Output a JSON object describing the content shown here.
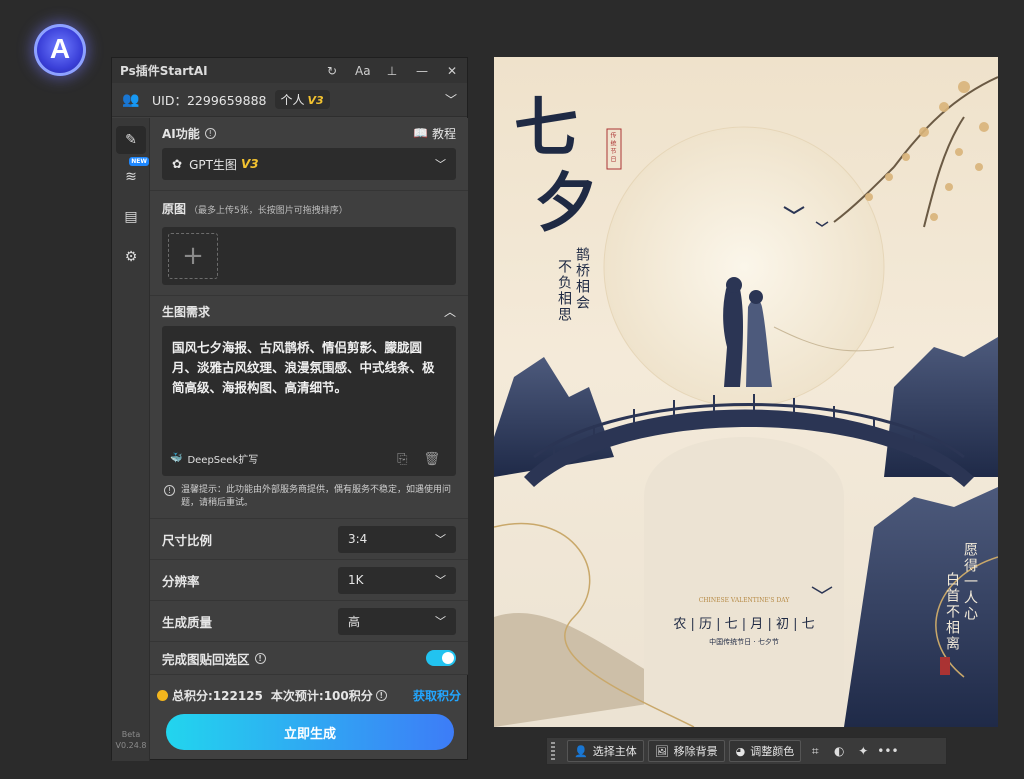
{
  "app": {
    "logo_letter": "A"
  },
  "panel": {
    "title": "Ps插件StartAI",
    "titlebar_icons": [
      "refresh-icon",
      "font-size-icon",
      "pin-icon",
      "minimize-icon",
      "close-icon"
    ],
    "titlebar_glyphs": {
      "refresh": "↻",
      "font": "Aa",
      "pin": "⊥",
      "minimize": "—",
      "close": "✕"
    }
  },
  "user": {
    "uid": "UID：2299659888",
    "plan": "个人",
    "plan_version": "V3"
  },
  "sidebar": {
    "new_badge": "NEW",
    "version_line1": "Beta",
    "version_line2": "V0.24.8"
  },
  "ai": {
    "label": "AI功能",
    "tutorial": "教程",
    "model": "GPT生图",
    "model_version": "V3"
  },
  "source": {
    "label": "原图",
    "hint": "（最多上传5张，长按图片可拖拽排序）",
    "add": "+"
  },
  "prompt": {
    "label": "生图需求",
    "text": "国风七夕海报、古风鹊桥、情侣剪影、朦胧圆月、淡雅古风纹理、浪漫氛围感、中式线条、极简高级、海报构图、高清细节。",
    "deepseek": "DeepSeek扩写"
  },
  "notice": "温馨提示：此功能由外部服务商提供，偶有服务不稳定，如遇使用问题，请稍后重试。",
  "settings": {
    "ratio_label": "尺寸比例",
    "ratio_value": "3:4",
    "res_label": "分辨率",
    "res_value": "1K",
    "quality_label": "生成质量",
    "quality_value": "高",
    "paste_label": "完成图贴回选区",
    "paste_on": true
  },
  "points": {
    "total": "总积分:122125",
    "estimate": "本次预计:100积分",
    "get": "获取积分"
  },
  "generate_label": "立即生成",
  "poster": {
    "title_qi": "七",
    "title_xi": "夕",
    "seal": "传统节日",
    "line1": "鹊桥相会",
    "line2": "不负相思",
    "en": "CHINESE VALENTINE'S DAY",
    "date": "农 | 历 | 七 | 月 | 初 | 七",
    "sub": "中国传统节日 · 七夕节",
    "right1": "愿得一人心",
    "right2": "白首不相离"
  },
  "bottom_bar": {
    "select_subject": "选择主体",
    "remove_bg": "移除背景",
    "adjust_color": "调整颜色",
    "more": "•••"
  },
  "colors": {
    "accent": "#22c3f0",
    "gold": "#f2c230",
    "link": "#22a6ff"
  }
}
